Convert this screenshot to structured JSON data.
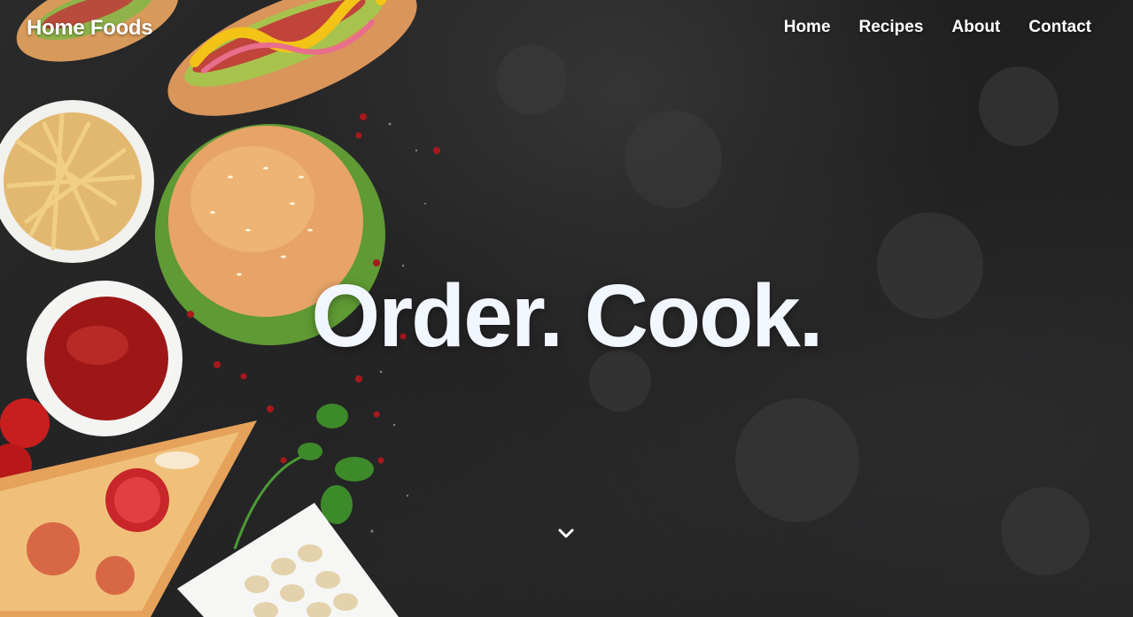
{
  "header": {
    "logo": "Home Foods",
    "nav": [
      {
        "label": "Home"
      },
      {
        "label": "Recipes"
      },
      {
        "label": "About"
      },
      {
        "label": "Contact"
      }
    ]
  },
  "hero": {
    "headline": "Order. Cook.",
    "scroll_icon": "chevron-down-icon",
    "background_image": "food-flatlay-photo"
  },
  "colors": {
    "background": "#1e1e1f",
    "headline_text": "#f2f6ff",
    "nav_text": "#ffffff"
  }
}
